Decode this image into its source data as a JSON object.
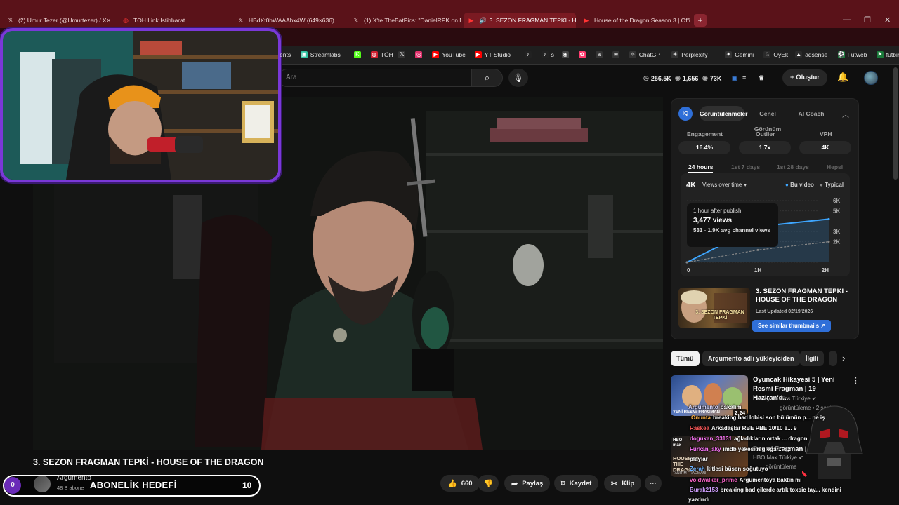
{
  "tabs": [
    {
      "label": "(2) Umur Tezer (@Umurtezer) / X",
      "icon": "x-logo-icon"
    },
    {
      "label": "TÖH Link İstihbarat",
      "icon": "toh-icon"
    },
    {
      "label": "HBdXt0hWAAAbx4W (649×636)",
      "icon": "x-logo-icon"
    },
    {
      "label": "(1) X'te TheBatPics: \"DanielRPK on D",
      "icon": "x-logo-icon"
    },
    {
      "label": "3. SEZON FRAGMAN TEPKİ - H",
      "icon": "youtube-icon"
    },
    {
      "label": "House of the Dragon Season 3 | Offi",
      "icon": "youtube-icon"
    }
  ],
  "bookmarks": [
    {
      "label": "ents",
      "color": "#555555",
      "glyph": ""
    },
    {
      "label": "Streamlabs",
      "color": "#31c3a2",
      "glyph": "▣"
    },
    {
      "label": "",
      "color": "#53fc18",
      "glyph": "K"
    },
    {
      "label": "TÖH",
      "color": "#d02030",
      "glyph": "◍"
    },
    {
      "label": "",
      "color": "#333333",
      "glyph": "𝕏"
    },
    {
      "label": "",
      "color": "#e1306c",
      "glyph": "◎"
    },
    {
      "label": "YouTube",
      "color": "#ff0000",
      "glyph": "▶"
    },
    {
      "label": "YT Studio",
      "color": "#ff0000",
      "glyph": "▶"
    },
    {
      "label": "",
      "color": "#222222",
      "glyph": "♪"
    },
    {
      "label": "s",
      "color": "#222222",
      "glyph": "♪"
    },
    {
      "label": "",
      "color": "#444444",
      "glyph": "◉"
    },
    {
      "label": "",
      "color": "#ff3a6e",
      "glyph": "✿"
    },
    {
      "label": "",
      "color": "#333333",
      "glyph": "a"
    },
    {
      "label": "",
      "color": "#333333",
      "glyph": "✉"
    },
    {
      "label": "ChatGPT",
      "color": "#333333",
      "glyph": "✧"
    },
    {
      "label": "Perplexity",
      "color": "#333333",
      "glyph": "✳"
    },
    {
      "label": "Gemini",
      "color": "#333333",
      "glyph": "✦"
    },
    {
      "label": "OyEk",
      "color": "#2a2a2a",
      "glyph": "♘"
    },
    {
      "label": "adsense",
      "color": "#2a2a2a",
      "glyph": "▲"
    },
    {
      "label": "Futweb",
      "color": "#1a7a3a",
      "glyph": "⚽"
    },
    {
      "label": "futbin",
      "color": "#1a7a3a",
      "glyph": "⚑"
    }
  ],
  "header": {
    "search_placeholder": "Ara",
    "stats": [
      {
        "icon": "clock-icon",
        "value": "256.5K"
      },
      {
        "icon": "eye-icon",
        "value": "1,656"
      },
      {
        "icon": "eye-icon",
        "value": "73K"
      }
    ],
    "create_label": "Oluştur"
  },
  "video": {
    "title": "3. SEZON FRAGMAN TEPKİ - HOUSE OF THE DRAGON",
    "channel_name": "Argumento",
    "subscribers": "48 B abone",
    "likes": "660",
    "share_label": "Paylaş",
    "save_label": "Kaydet",
    "clip_label": "Klip"
  },
  "sub_goal": {
    "start": "0",
    "label": "ABONELİK HEDEFİ",
    "end": "10",
    "progress": 0
  },
  "analytics": {
    "badge": "IQ",
    "tabs": [
      "Görüntülenmeler",
      "Genel Görünüm",
      "AI Coach"
    ],
    "metrics": [
      {
        "label": "Engagement",
        "value": "16.4%"
      },
      {
        "label": "Outlier",
        "value": "1.7x"
      },
      {
        "label": "VPH",
        "value": "4K"
      }
    ],
    "time_tabs": [
      "24 hours",
      "1st 7 days",
      "1st 28 days",
      "Hepsi"
    ],
    "chart_value": "4K",
    "chart_dropdown": "Views over time",
    "legend": [
      "Bu video",
      "Typical"
    ],
    "tooltip": {
      "line1": "1 hour after publish",
      "line2": "3,477 views",
      "line3": "531 - 1.9K avg channel views"
    },
    "card": {
      "title": "3. SEZON FRAGMAN TEPKİ - HOUSE OF THE DRAGON",
      "updated": "Last Updated 02/19/2026",
      "button": "See similar thumbnails",
      "thumb_text": "3. SEZON FRAGMAN TEPKİ"
    }
  },
  "chart_data": {
    "type": "line",
    "x": [
      "0",
      "1H",
      "2H"
    ],
    "yticks": [
      "6K",
      "5K",
      "3K",
      "2K",
      "0"
    ],
    "series": [
      {
        "name": "Bu video",
        "color": "#3ea6ff",
        "values": [
          0,
          3477,
          4200
        ]
      },
      {
        "name": "Typical",
        "color": "#888888",
        "values": [
          0,
          1200,
          2000
        ]
      }
    ]
  },
  "chips": [
    "Tümü",
    "Argumento adlı yükleyiciden",
    "İlgili"
  ],
  "recommendations": [
    {
      "title": "Oyuncak Hikayesi 5 | Yeni Resmi Fragman | 19 Haziran'd...",
      "channel": "Disney Studios Türkiye",
      "meta": "görüntüleme • 2 saat",
      "duration": "2:24",
      "thumb_text": "YENİ RESMİ FRAGMAN"
    },
    {
      "title": "Resmi Fragman | HBO Max",
      "channel": "HBO Max Türkiye",
      "meta": "görüntüleme",
      "duration": "",
      "thumb_text": "HOUSE OF THE DRAGON",
      "thumb_sub": "TANITIM FRAGMANI",
      "badge": "HBO max"
    }
  ],
  "chat": [
    {
      "user": "Argumento",
      "color": "#d8d8ff",
      "text": "bakalım"
    },
    {
      "user": "Onunta",
      "color": "#ffb347",
      "text": "breaking bad lobisi son bülümün p... ne iş"
    },
    {
      "user": "Raskea",
      "color": "#ff5a5a",
      "text": "Arkadaşlar RBE PBE 10/10 e... 9"
    },
    {
      "user": "dogukan_33131",
      "color": "#ff77ff",
      "text": "ağladıkların ortak ... dragon"
    },
    {
      "user": "Furkan_aky",
      "color": "#ff77ff",
      "text": "imdb yekesiin giegar... az"
    },
    {
      "user": "playlar",
      "color": "#ffffff",
      "text": ""
    },
    {
      "user": "Zerah",
      "color": "#6ab0ff",
      "text": "kitlesi büsen soğutuyo"
    },
    {
      "user": "voidwalker_prime",
      "color": "#ff66cc",
      "text": "Argumentoya baktın mı"
    },
    {
      "user": "Burak2153",
      "color": "#d0a0ff",
      "text": "breaking bad çilerde artık toxsic tay... kendini"
    },
    {
      "user": "yazdırdı",
      "color": "#ffffff",
      "text": ""
    }
  ]
}
